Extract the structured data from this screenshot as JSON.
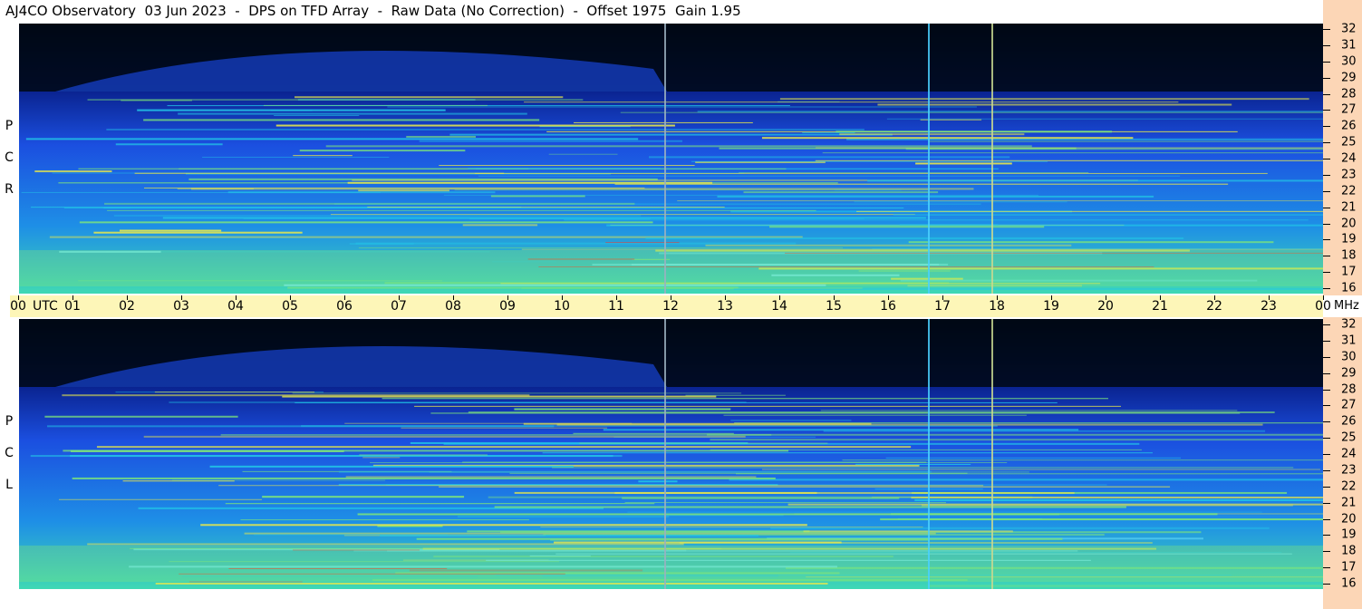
{
  "title": "AJ4CO Observatory  03 Jun 2023  -  DPS on TFD Array  -  Raw Data (No Correction)  -  Offset 1975  Gain 1.95",
  "panels": [
    {
      "id": "rcp",
      "letters": [
        "P",
        "C",
        "R"
      ]
    },
    {
      "id": "lcp",
      "letters": [
        "P",
        "C",
        "L"
      ]
    }
  ],
  "frequency_axis": {
    "unit": "MHz",
    "ticks": [
      "32",
      "31",
      "30",
      "29",
      "28",
      "27",
      "26",
      "25",
      "24",
      "23",
      "22",
      "21",
      "20",
      "19",
      "18",
      "17",
      "16"
    ]
  },
  "time_axis": {
    "utc_label": "UTC",
    "ticks": [
      "00",
      "01",
      "02",
      "03",
      "04",
      "05",
      "06",
      "07",
      "08",
      "09",
      "10",
      "11",
      "12",
      "13",
      "14",
      "15",
      "16",
      "17",
      "18",
      "19",
      "20",
      "21",
      "22",
      "23",
      "00"
    ]
  },
  "colors": {
    "background_dark": "#000814",
    "blue": "#1b4fe0",
    "cyan": "#22c4e6",
    "green": "#7ee67a",
    "yellow": "#e8e84a",
    "red": "#e03c3c",
    "axis_freq_bg": "#fcd6b6",
    "axis_time_bg": "#fdf6b8"
  }
}
